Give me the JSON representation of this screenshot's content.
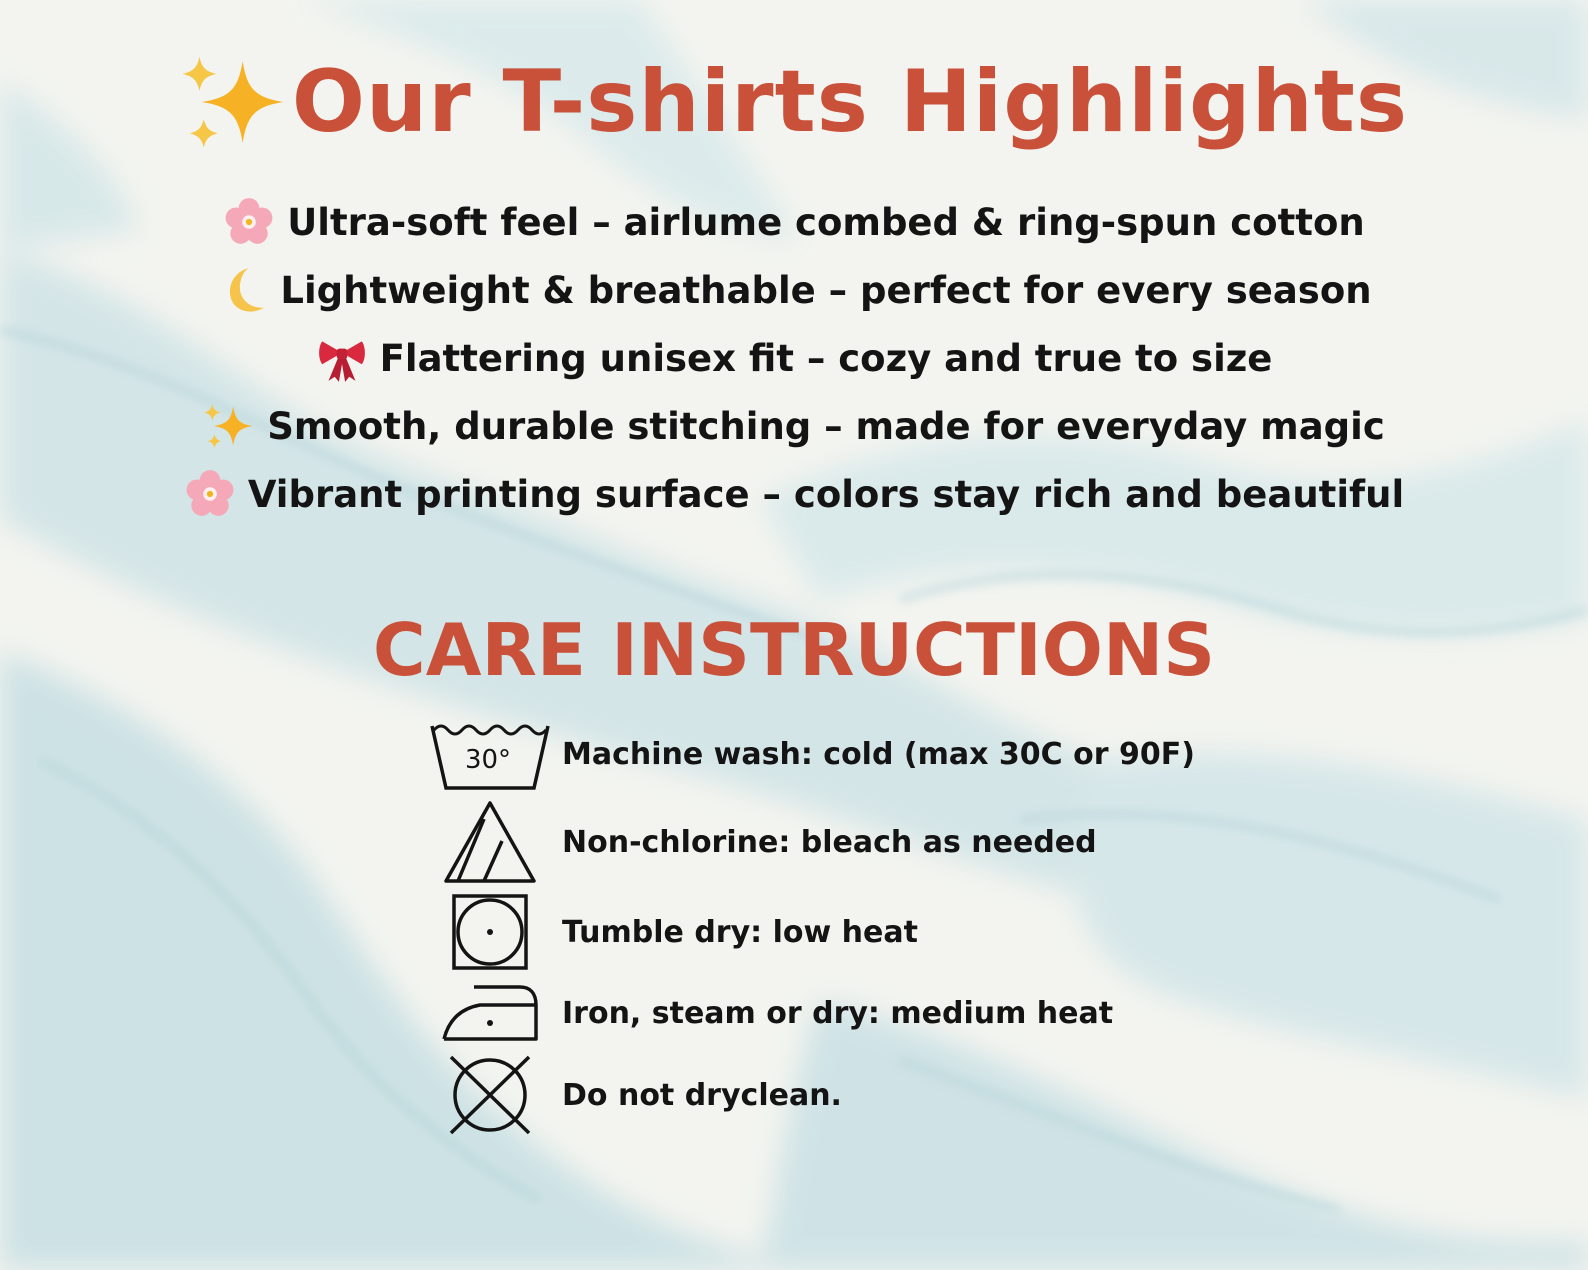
{
  "colors": {
    "accent": "#c9513a",
    "text": "#141414",
    "background": "#f3f4ef",
    "marble": "#bcd9de"
  },
  "highlights": {
    "title": "Our T-shirts Highlights",
    "title_icon": "sparkles-icon",
    "items": [
      {
        "icon": "cherry-blossom-icon",
        "text": "Ultra-soft feel – airlume combed & ring-spun cotton"
      },
      {
        "icon": "crescent-moon-icon",
        "text": "Lightweight & breathable – perfect for every season"
      },
      {
        "icon": "ribbon-icon",
        "text": "Flattering unisex fit – cozy and true to size"
      },
      {
        "icon": "sparkles-icon",
        "text": "Smooth, durable stitching – made for everyday magic"
      },
      {
        "icon": "cherry-blossom-icon",
        "text": "Vibrant printing surface – colors stay rich and beautiful"
      }
    ]
  },
  "care": {
    "title": "CARE INSTRUCTIONS",
    "items": [
      {
        "icon": "wash-tub-icon",
        "symbol_text": "30°",
        "text": "Machine wash: cold (max 30C or 90F)"
      },
      {
        "icon": "non-chlorine-bleach-icon",
        "text": "Non-chlorine: bleach as needed"
      },
      {
        "icon": "tumble-dry-low-icon",
        "text": "Tumble dry: low heat"
      },
      {
        "icon": "iron-medium-icon",
        "text": "Iron, steam or dry: medium heat"
      },
      {
        "icon": "do-not-dryclean-icon",
        "text": "Do not dryclean."
      }
    ]
  }
}
